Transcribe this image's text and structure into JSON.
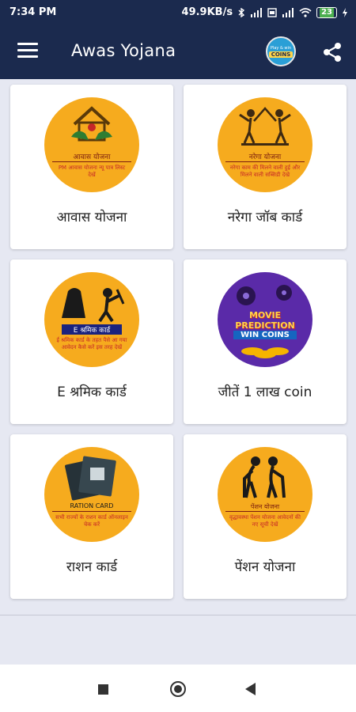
{
  "status_bar": {
    "time": "7:34 PM",
    "speed": "49.9KB/s",
    "battery": "23"
  },
  "app_bar": {
    "title": "Awas Yojana",
    "coins_badge": {
      "small_text": "Play & win",
      "big_text": "COINS"
    }
  },
  "cards": [
    {
      "label": "आवास योजना",
      "badge_title": "आवास योजना",
      "badge_text": "PM आवास योजना न्यू पात्र लिस्ट देखें",
      "icon": "house-hands-icon"
    },
    {
      "label": "नरेगा जॉब कार्ड",
      "badge_title": "नरेगा योजना",
      "badge_text": "नरेगा काम की मिलने वाली हुई और मिलने वाली सब्सिडी देखे",
      "icon": "workers-icon"
    },
    {
      "label": "E श्रमिक कार्ड",
      "badge_title": "E श्रमिक कार्ड",
      "badge_text": "ई श्रमिक कार्ड के तहत पैसे आ गया आवेदन कैसे करें इस तरह देखें",
      "icon": "labourer-icon"
    },
    {
      "label": "जीतें 1 लाख coin",
      "badge_title": "MOVIE PREDICTION",
      "badge_text": "WIN COINS",
      "icon": "film-reel-icon"
    },
    {
      "label": "राशन कार्ड",
      "badge_title": "RATION CARD",
      "badge_text": "सभी राज्यों के राशन कार्ड ऑनलाइन चेक करें",
      "icon": "ration-card-icon"
    },
    {
      "label": "पेंशन योजना",
      "badge_title": "पेंशन योजना",
      "badge_text": "वृद्धावस्था पेंशन योजना आवेदनों की नए सूची देखें",
      "icon": "elderly-couple-icon"
    }
  ],
  "colors": {
    "app_bar": "#1b2a4e",
    "badge_orange": "#f6ab1e",
    "background": "#e6e8f2"
  }
}
